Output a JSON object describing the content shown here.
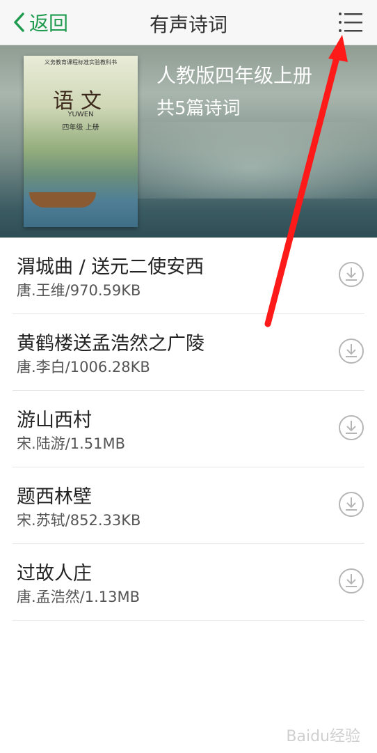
{
  "header": {
    "back_label": "返回",
    "title": "有声诗词",
    "accent": "#1f9b4f"
  },
  "banner": {
    "title": "人教版四年级上册",
    "subtitle": "共5篇诗词",
    "cover": {
      "publisher_line": "义务教育课程标准实验教科书",
      "logo": "语文",
      "pinyin": "YUWEN",
      "grade": "四年级 上册"
    }
  },
  "poems": [
    {
      "title": "渭城曲 / 送元二使安西",
      "meta": "唐.王维/970.59KB"
    },
    {
      "title": "黄鹤楼送孟浩然之广陵",
      "meta": "唐.李白/1006.28KB"
    },
    {
      "title": "游山西村",
      "meta": "宋.陆游/1.51MB"
    },
    {
      "title": "题西林壁",
      "meta": "宋.苏轼/852.33KB"
    },
    {
      "title": "过故人庄",
      "meta": "唐.孟浩然/1.13MB"
    }
  ],
  "watermark": "Baidu经验",
  "annotation_color": "#ff1a1a"
}
